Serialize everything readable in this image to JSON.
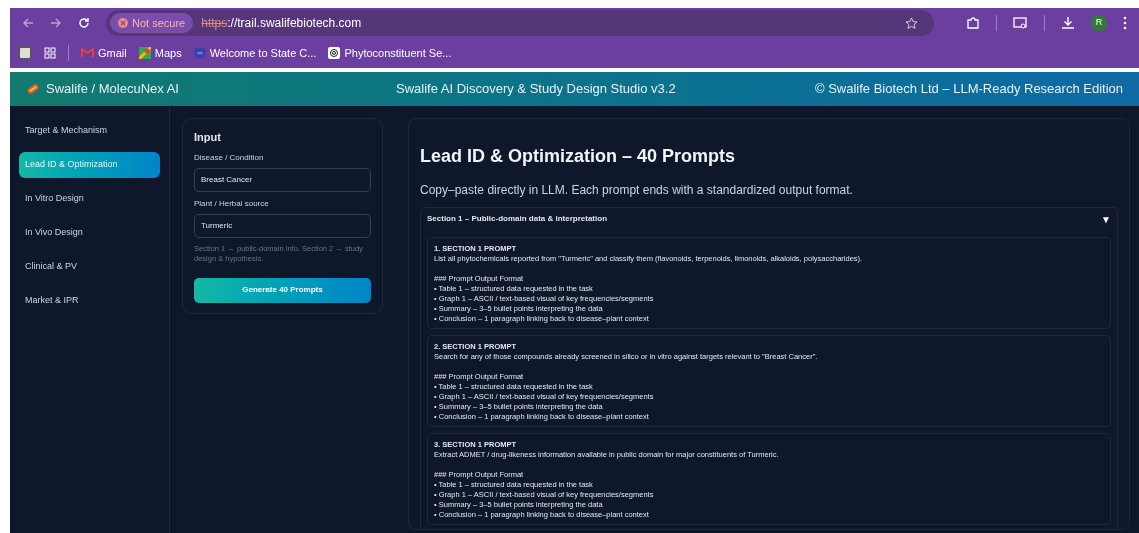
{
  "browser": {
    "security": "Not secure",
    "url_scheme": "https",
    "url_rest": "://trail.swalifebiotech.com",
    "profile_initial": "R",
    "bookmarks": [
      {
        "label": "Gmail",
        "kind": "mail"
      },
      {
        "label": "Maps",
        "kind": "map"
      },
      {
        "label": "Welcome to State C...",
        "kind": "globe"
      },
      {
        "label": "Phytoconstituent Se...",
        "kind": "ai"
      }
    ]
  },
  "header": {
    "brand": "Swalife / MolecuNex AI",
    "title": "Swalife AI Discovery & Study Design Studio v3.2",
    "copyright": "© Swalife Biotech Ltd – LLM-Ready Research Edition"
  },
  "sidebar": {
    "items": [
      {
        "label": "Target & Mechanism",
        "selected": false
      },
      {
        "label": "Lead ID & Optimization",
        "selected": true
      },
      {
        "label": "In Vitro Design",
        "selected": false
      },
      {
        "label": "In Vivo Design",
        "selected": false
      },
      {
        "label": "Clinical & PV",
        "selected": false
      },
      {
        "label": "Market & IPR",
        "selected": false
      }
    ]
  },
  "input_panel": {
    "title": "Input",
    "fields": [
      {
        "label": "Disease / Condition",
        "value": "Breast Cancer"
      },
      {
        "label": "Plant / Herbal source",
        "value": "Turmeric"
      }
    ],
    "hint": "Section 1 → public-domain info. Section 2 → study design & hypothesis.",
    "button": "Generate 40 Prompts"
  },
  "main": {
    "title": "Lead ID & Optimization – 40 Prompts",
    "subtitle": "Copy–paste directly in LLM. Each prompt ends with a standardized output format.",
    "section": {
      "title": "Section 1 – Public-domain data & interpretation",
      "expanded": true,
      "toggle": "▼",
      "prompts": [
        {
          "title": "1. SECTION 1 PROMPT",
          "text": "List all phytochemicals reported from \"Turmeric\" and classify them (flavonoids, terpenoids, limonoids, alkaloids, polysaccharides).",
          "format_heading": "### Prompt Output Format",
          "format_items": [
            "• Table 1 – structured data requested in the task",
            "• Graph 1 – ASCII / text-based visual of key frequencies/segments",
            "• Summary – 3–5 bullet points interpreting the data",
            "• Conclusion – 1 paragraph linking back to disease–plant context"
          ]
        },
        {
          "title": "2. SECTION 1 PROMPT",
          "text": "Search for any of those compounds already screened in silico or in vitro against targets relevant to \"Breast Cancer\".",
          "format_heading": "### Prompt Output Format",
          "format_items": [
            "• Table 1 – structured data requested in the task",
            "• Graph 1 – ASCII / text-based visual of key frequencies/segments",
            "• Summary – 3–5 bullet points interpreting the data",
            "• Conclusion – 1 paragraph linking back to disease–plant context"
          ]
        },
        {
          "title": "3. SECTION 1 PROMPT",
          "text": "Extract ADMET / drug-likeness information available in public domain for major constituents of Turmeric.",
          "format_heading": "### Prompt Output Format",
          "format_items": [
            "• Table 1 – structured data requested in the task",
            "• Graph 1 – ASCII / text-based visual of key frequencies/segments",
            "• Summary – 3–5 bullet points interpreting the data",
            "• Conclusion – 1 paragraph linking back to disease–plant context"
          ]
        }
      ]
    }
  }
}
